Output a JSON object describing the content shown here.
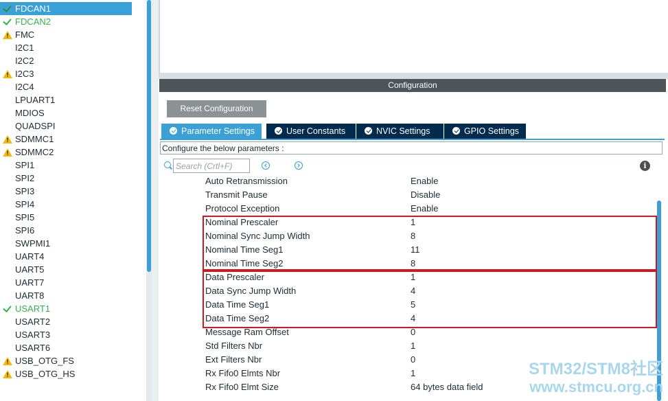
{
  "peripherals": [
    {
      "label": "FDCAN1",
      "status": "ok",
      "selected": true
    },
    {
      "label": "FDCAN2",
      "status": "ok"
    },
    {
      "label": "FMC",
      "status": "warn"
    },
    {
      "label": "I2C1"
    },
    {
      "label": "I2C2"
    },
    {
      "label": "I2C3",
      "status": "warn"
    },
    {
      "label": "I2C4"
    },
    {
      "label": "LPUART1"
    },
    {
      "label": "MDIOS"
    },
    {
      "label": "QUADSPI"
    },
    {
      "label": "SDMMC1",
      "status": "warn"
    },
    {
      "label": "SDMMC2",
      "status": "warn"
    },
    {
      "label": "SPI1"
    },
    {
      "label": "SPI2"
    },
    {
      "label": "SPI3"
    },
    {
      "label": "SPI4"
    },
    {
      "label": "SPI5"
    },
    {
      "label": "SPI6"
    },
    {
      "label": "SWPMI1"
    },
    {
      "label": "UART4"
    },
    {
      "label": "UART5"
    },
    {
      "label": "UART7"
    },
    {
      "label": "UART8"
    },
    {
      "label": "USART1",
      "status": "ok"
    },
    {
      "label": "USART2"
    },
    {
      "label": "USART3"
    },
    {
      "label": "USART6"
    },
    {
      "label": "USB_OTG_FS",
      "status": "warn"
    },
    {
      "label": "USB_OTG_HS",
      "status": "warn"
    }
  ],
  "config": {
    "header": "Configuration",
    "reset_label": "Reset Configuration",
    "configure_text": "Configure the below parameters :",
    "search_placeholder": "Search (Crtl+F)"
  },
  "tabs": [
    {
      "label": "Parameter Settings",
      "active": true
    },
    {
      "label": "User Constants"
    },
    {
      "label": "NVIC Settings"
    },
    {
      "label": "GPIO Settings"
    }
  ],
  "parameters": [
    {
      "name": "Auto Retransmission",
      "value": "Enable"
    },
    {
      "name": "Transmit Pause",
      "value": "Disable"
    },
    {
      "name": "Protocol Exception",
      "value": "Enable"
    },
    {
      "name": "Nominal Prescaler",
      "value": "1"
    },
    {
      "name": "Nominal Sync Jump Width",
      "value": "8"
    },
    {
      "name": "Nominal Time Seg1",
      "value": "11"
    },
    {
      "name": "Nominal Time Seg2",
      "value": "8"
    },
    {
      "name": "Data Prescaler",
      "value": "1"
    },
    {
      "name": "Data Sync Jump Width",
      "value": "4"
    },
    {
      "name": "Data Time Seg1",
      "value": "5"
    },
    {
      "name": "Data Time Seg2",
      "value": "4"
    },
    {
      "name": "Message Ram Offset",
      "value": "0"
    },
    {
      "name": "Std Filters Nbr",
      "value": "1"
    },
    {
      "name": "Ext Filters Nbr",
      "value": "0"
    },
    {
      "name": "Rx Fifo0 Elmts Nbr",
      "value": "1"
    },
    {
      "name": "Rx Fifo0 Elmt Size",
      "value": "64 bytes data field"
    }
  ],
  "watermark": {
    "line1": "STM32/STM8社区",
    "line2": "www.stmcu.org.cn"
  },
  "colors": {
    "accent": "#3aa0d5",
    "tab_dark": "#002b4d",
    "highlight_box": "#cc1a25",
    "ok_green": "#3cae4e",
    "warn_yellow": "#f2b90f"
  }
}
